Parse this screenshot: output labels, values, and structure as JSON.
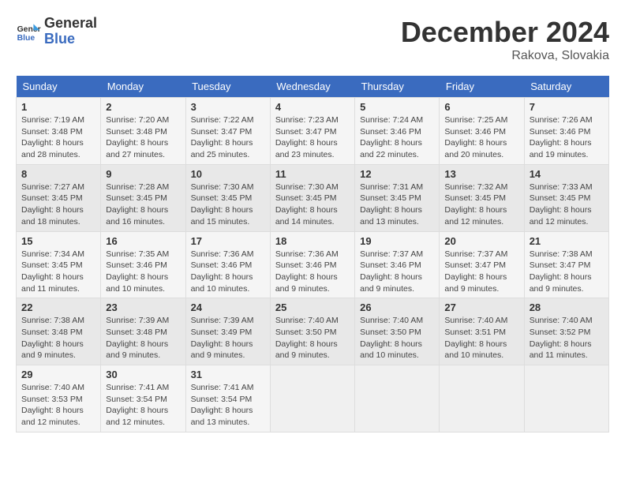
{
  "header": {
    "logo_line1": "General",
    "logo_line2": "Blue",
    "month": "December 2024",
    "location": "Rakova, Slovakia"
  },
  "weekdays": [
    "Sunday",
    "Monday",
    "Tuesday",
    "Wednesday",
    "Thursday",
    "Friday",
    "Saturday"
  ],
  "weeks": [
    [
      {
        "day": "1",
        "sunrise": "7:19 AM",
        "sunset": "3:48 PM",
        "daylight": "8 hours and 28 minutes."
      },
      {
        "day": "2",
        "sunrise": "7:20 AM",
        "sunset": "3:48 PM",
        "daylight": "8 hours and 27 minutes."
      },
      {
        "day": "3",
        "sunrise": "7:22 AM",
        "sunset": "3:47 PM",
        "daylight": "8 hours and 25 minutes."
      },
      {
        "day": "4",
        "sunrise": "7:23 AM",
        "sunset": "3:47 PM",
        "daylight": "8 hours and 23 minutes."
      },
      {
        "day": "5",
        "sunrise": "7:24 AM",
        "sunset": "3:46 PM",
        "daylight": "8 hours and 22 minutes."
      },
      {
        "day": "6",
        "sunrise": "7:25 AM",
        "sunset": "3:46 PM",
        "daylight": "8 hours and 20 minutes."
      },
      {
        "day": "7",
        "sunrise": "7:26 AM",
        "sunset": "3:46 PM",
        "daylight": "8 hours and 19 minutes."
      }
    ],
    [
      {
        "day": "8",
        "sunrise": "7:27 AM",
        "sunset": "3:45 PM",
        "daylight": "8 hours and 18 minutes."
      },
      {
        "day": "9",
        "sunrise": "7:28 AM",
        "sunset": "3:45 PM",
        "daylight": "8 hours and 16 minutes."
      },
      {
        "day": "10",
        "sunrise": "7:30 AM",
        "sunset": "3:45 PM",
        "daylight": "8 hours and 15 minutes."
      },
      {
        "day": "11",
        "sunrise": "7:30 AM",
        "sunset": "3:45 PM",
        "daylight": "8 hours and 14 minutes."
      },
      {
        "day": "12",
        "sunrise": "7:31 AM",
        "sunset": "3:45 PM",
        "daylight": "8 hours and 13 minutes."
      },
      {
        "day": "13",
        "sunrise": "7:32 AM",
        "sunset": "3:45 PM",
        "daylight": "8 hours and 12 minutes."
      },
      {
        "day": "14",
        "sunrise": "7:33 AM",
        "sunset": "3:45 PM",
        "daylight": "8 hours and 12 minutes."
      }
    ],
    [
      {
        "day": "15",
        "sunrise": "7:34 AM",
        "sunset": "3:45 PM",
        "daylight": "8 hours and 11 minutes."
      },
      {
        "day": "16",
        "sunrise": "7:35 AM",
        "sunset": "3:46 PM",
        "daylight": "8 hours and 10 minutes."
      },
      {
        "day": "17",
        "sunrise": "7:36 AM",
        "sunset": "3:46 PM",
        "daylight": "8 hours and 10 minutes."
      },
      {
        "day": "18",
        "sunrise": "7:36 AM",
        "sunset": "3:46 PM",
        "daylight": "8 hours and 9 minutes."
      },
      {
        "day": "19",
        "sunrise": "7:37 AM",
        "sunset": "3:46 PM",
        "daylight": "8 hours and 9 minutes."
      },
      {
        "day": "20",
        "sunrise": "7:37 AM",
        "sunset": "3:47 PM",
        "daylight": "8 hours and 9 minutes."
      },
      {
        "day": "21",
        "sunrise": "7:38 AM",
        "sunset": "3:47 PM",
        "daylight": "8 hours and 9 minutes."
      }
    ],
    [
      {
        "day": "22",
        "sunrise": "7:38 AM",
        "sunset": "3:48 PM",
        "daylight": "8 hours and 9 minutes."
      },
      {
        "day": "23",
        "sunrise": "7:39 AM",
        "sunset": "3:48 PM",
        "daylight": "8 hours and 9 minutes."
      },
      {
        "day": "24",
        "sunrise": "7:39 AM",
        "sunset": "3:49 PM",
        "daylight": "8 hours and 9 minutes."
      },
      {
        "day": "25",
        "sunrise": "7:40 AM",
        "sunset": "3:50 PM",
        "daylight": "8 hours and 9 minutes."
      },
      {
        "day": "26",
        "sunrise": "7:40 AM",
        "sunset": "3:50 PM",
        "daylight": "8 hours and 10 minutes."
      },
      {
        "day": "27",
        "sunrise": "7:40 AM",
        "sunset": "3:51 PM",
        "daylight": "8 hours and 10 minutes."
      },
      {
        "day": "28",
        "sunrise": "7:40 AM",
        "sunset": "3:52 PM",
        "daylight": "8 hours and 11 minutes."
      }
    ],
    [
      {
        "day": "29",
        "sunrise": "7:40 AM",
        "sunset": "3:53 PM",
        "daylight": "8 hours and 12 minutes."
      },
      {
        "day": "30",
        "sunrise": "7:41 AM",
        "sunset": "3:54 PM",
        "daylight": "8 hours and 12 minutes."
      },
      {
        "day": "31",
        "sunrise": "7:41 AM",
        "sunset": "3:54 PM",
        "daylight": "8 hours and 13 minutes."
      },
      null,
      null,
      null,
      null
    ]
  ]
}
